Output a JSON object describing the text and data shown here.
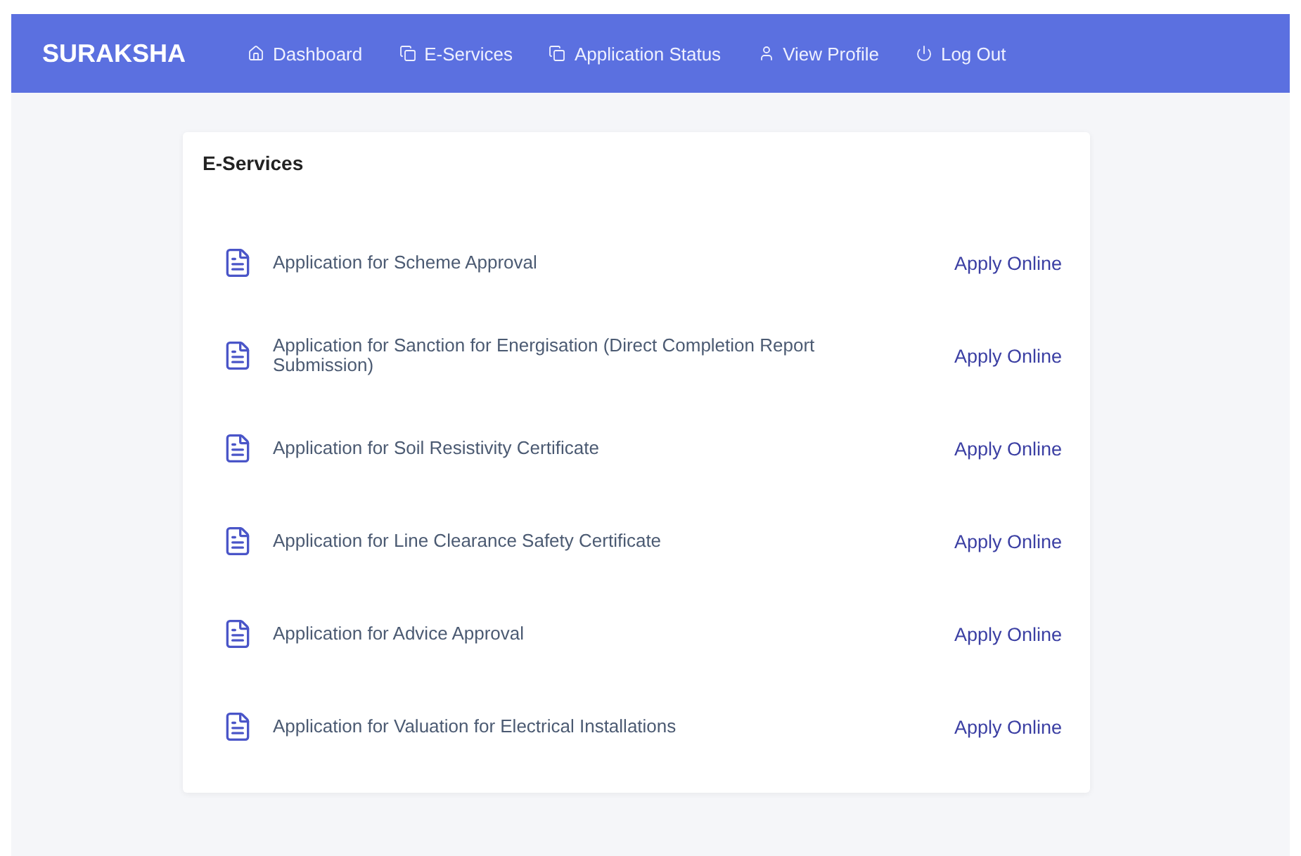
{
  "brand": "SURAKSHA",
  "nav": [
    {
      "label": "Dashboard",
      "kind": "home"
    },
    {
      "label": "E-Services",
      "kind": "tabs"
    },
    {
      "label": "Application Status",
      "kind": "tabs"
    },
    {
      "label": "View Profile",
      "kind": "user"
    },
    {
      "label": "Log Out",
      "kind": "power"
    }
  ],
  "card": {
    "title": "E-Services",
    "services": [
      {
        "name": "Application for Scheme Approval",
        "action": "Apply Online"
      },
      {
        "name": "Application for Sanction for Energisation (Direct Completion Report Submission)",
        "action": "Apply Online"
      },
      {
        "name": "Application for Soil Resistivity Certificate",
        "action": "Apply Online"
      },
      {
        "name": "Application for Line Clearance Safety Certificate",
        "action": "Apply Online"
      },
      {
        "name": "Application for Advice Approval",
        "action": "Apply Online"
      },
      {
        "name": "Application for Valuation for Electrical Installations",
        "action": "Apply Online"
      }
    ]
  }
}
